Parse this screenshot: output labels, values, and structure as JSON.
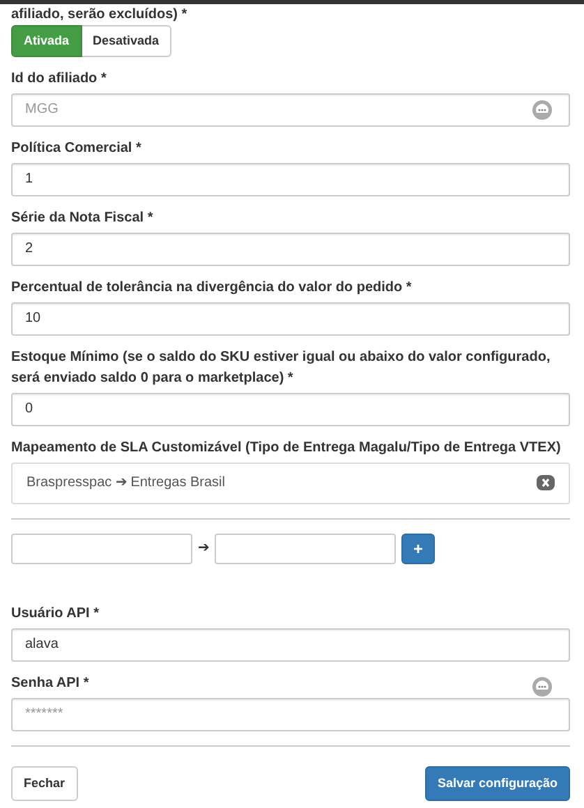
{
  "toggle_label": "afiliado, serão excluídos) *",
  "toggle": [
    {
      "label": "Ativada",
      "selected": true
    },
    {
      "label": "Desativada",
      "selected": false
    }
  ],
  "fields": [
    {
      "kind": "text",
      "label": "Id do afiliado *",
      "placeholder": "MGG",
      "icon": true
    },
    {
      "kind": "text",
      "label": "Política Comercial *",
      "value": "1"
    },
    {
      "kind": "text",
      "label": "Série da Nota Fiscal *",
      "value": "2"
    },
    {
      "kind": "text",
      "label": "Percentual de tolerância na divergência do valor do pedido *",
      "value": "10"
    },
    {
      "kind": "text",
      "label": "Estoque Mínimo (se o saldo do SKU estiver igual ou abaixo do valor configurado, será enviado saldo 0 para o marketplace) *",
      "value": "0"
    }
  ],
  "sla": {
    "label": "Mapeamento de SLA Customizável (Tipo de Entrega Magalu/Tipo de Entrega VTEX)",
    "items": [
      {
        "from": "Braspresspac",
        "arrow": "➔",
        "to": "Entregas Brasil"
      }
    ],
    "new_arrow": "➔",
    "add_button": "+"
  },
  "api_fields": [
    {
      "kind": "text",
      "label": "Usuário API *",
      "value": "alava"
    },
    {
      "kind": "password",
      "label": "Senha API *",
      "placeholder": "*******",
      "icon": true
    }
  ],
  "footer": {
    "close": "Fechar",
    "save": "Salvar configuração"
  }
}
